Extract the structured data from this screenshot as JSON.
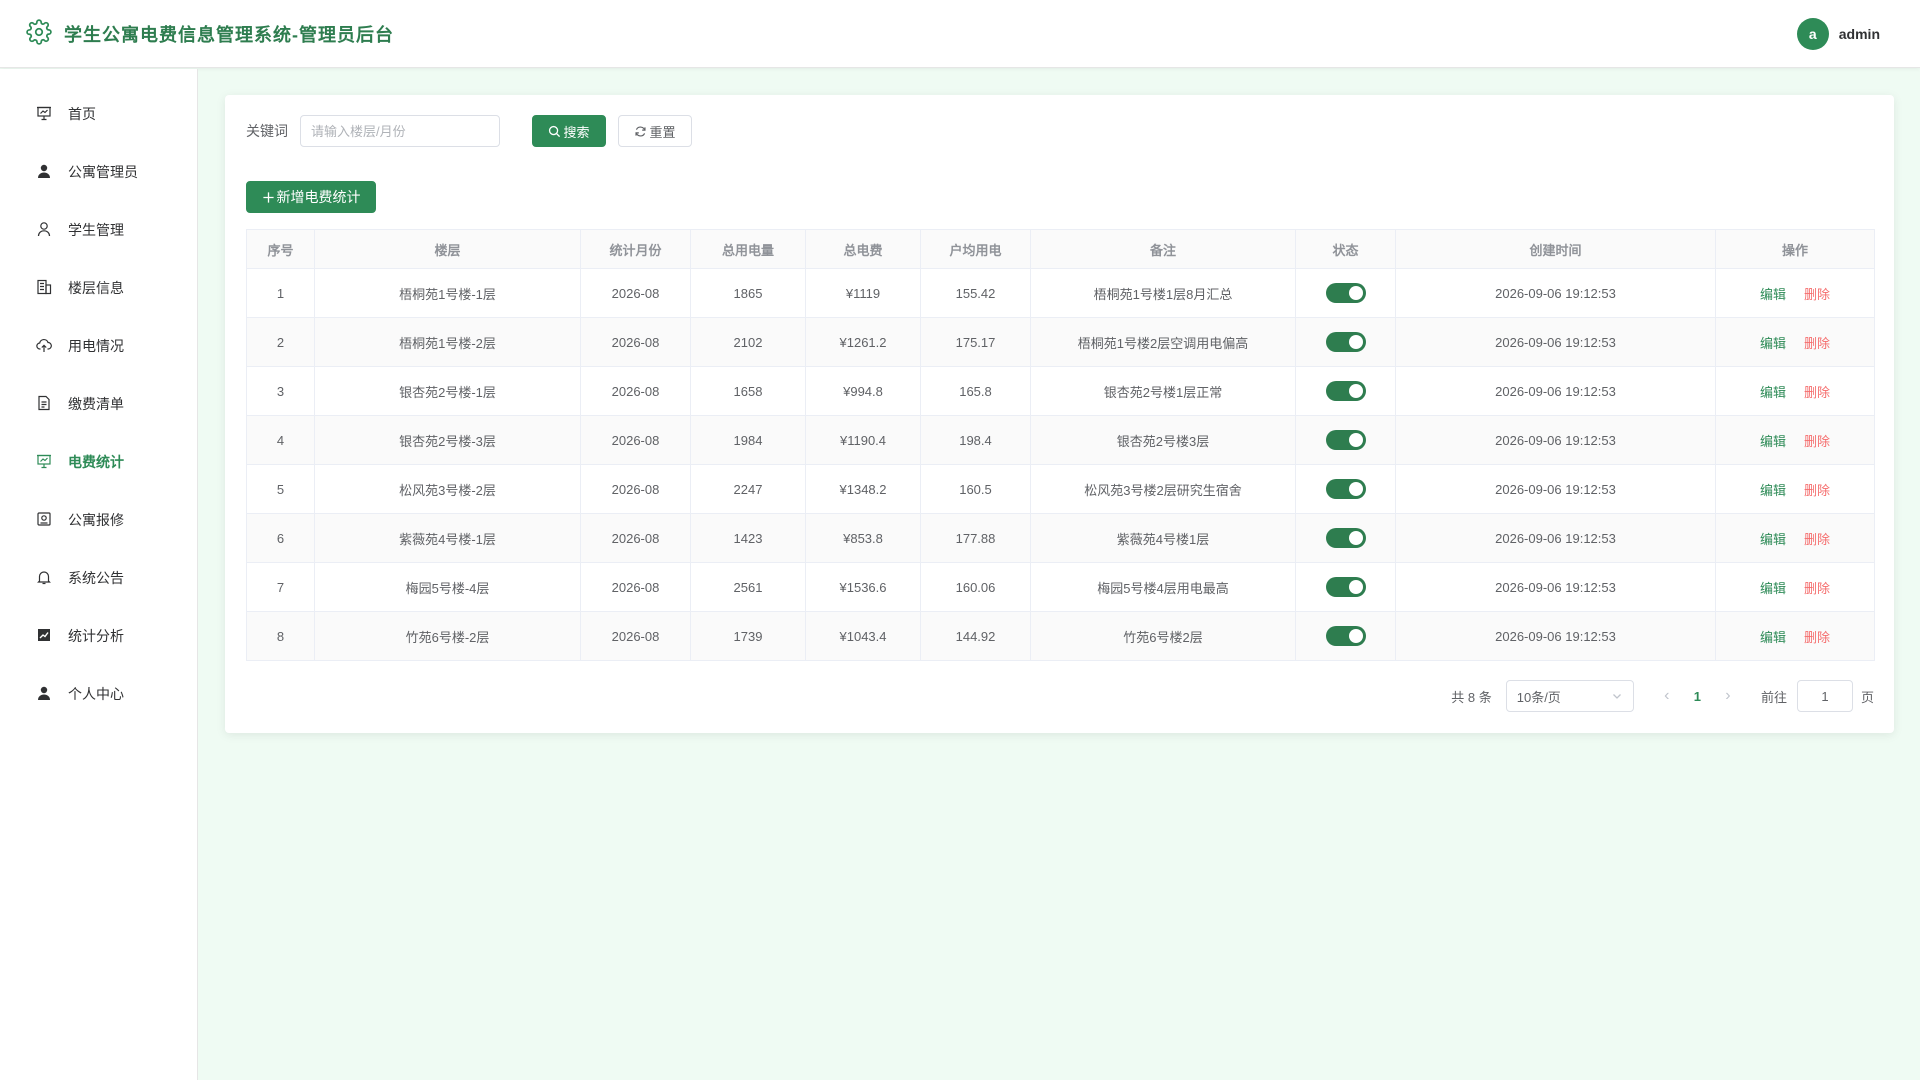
{
  "header": {
    "title": "学生公寓电费信息管理系统-管理员后台",
    "avatar_letter": "a",
    "username": "admin"
  },
  "sidebar": {
    "items": [
      {
        "label": "首页",
        "icon": "dashboard-icon",
        "active": false
      },
      {
        "label": "公寓管理员",
        "icon": "user-filled-icon",
        "active": false
      },
      {
        "label": "学生管理",
        "icon": "user-icon",
        "active": false
      },
      {
        "label": "楼层信息",
        "icon": "building-icon",
        "active": false
      },
      {
        "label": "用电情况",
        "icon": "upload-cloud-icon",
        "active": false
      },
      {
        "label": "缴费清单",
        "icon": "document-icon",
        "active": false
      },
      {
        "label": "电费统计",
        "icon": "presentation-icon",
        "active": true
      },
      {
        "label": "公寓报修",
        "icon": "repair-icon",
        "active": false
      },
      {
        "label": "系统公告",
        "icon": "bell-icon",
        "active": false
      },
      {
        "label": "统计分析",
        "icon": "chart-icon",
        "active": false
      },
      {
        "label": "个人中心",
        "icon": "user-filled-icon",
        "active": false
      }
    ]
  },
  "search": {
    "label": "关键词",
    "placeholder": "请输入楼层/月份",
    "value": "",
    "search_label": "搜索",
    "reset_label": "重置"
  },
  "toolbar": {
    "add_label": "新增电费统计"
  },
  "table": {
    "columns": [
      "序号",
      "楼层",
      "统计月份",
      "总用电量",
      "总电费",
      "户均用电",
      "备注",
      "状态",
      "创建时间",
      "操作"
    ],
    "edit_label": "编辑",
    "delete_label": "删除",
    "rows": [
      {
        "no": "1",
        "floor": "梧桐苑1号楼-1层",
        "month": "2026-08",
        "kwh": "1865",
        "fee": "¥1119",
        "avg": "155.42",
        "note": "梧桐苑1号楼1层8月汇总",
        "status": true,
        "created": "2026-09-06 19:12:53"
      },
      {
        "no": "2",
        "floor": "梧桐苑1号楼-2层",
        "month": "2026-08",
        "kwh": "2102",
        "fee": "¥1261.2",
        "avg": "175.17",
        "note": "梧桐苑1号楼2层空调用电偏高",
        "status": true,
        "created": "2026-09-06 19:12:53"
      },
      {
        "no": "3",
        "floor": "银杏苑2号楼-1层",
        "month": "2026-08",
        "kwh": "1658",
        "fee": "¥994.8",
        "avg": "165.8",
        "note": "银杏苑2号楼1层正常",
        "status": true,
        "created": "2026-09-06 19:12:53"
      },
      {
        "no": "4",
        "floor": "银杏苑2号楼-3层",
        "month": "2026-08",
        "kwh": "1984",
        "fee": "¥1190.4",
        "avg": "198.4",
        "note": "银杏苑2号楼3层",
        "status": true,
        "created": "2026-09-06 19:12:53"
      },
      {
        "no": "5",
        "floor": "松风苑3号楼-2层",
        "month": "2026-08",
        "kwh": "2247",
        "fee": "¥1348.2",
        "avg": "160.5",
        "note": "松风苑3号楼2层研究生宿舍",
        "status": true,
        "created": "2026-09-06 19:12:53"
      },
      {
        "no": "6",
        "floor": "紫薇苑4号楼-1层",
        "month": "2026-08",
        "kwh": "1423",
        "fee": "¥853.8",
        "avg": "177.88",
        "note": "紫薇苑4号楼1层",
        "status": true,
        "created": "2026-09-06 19:12:53"
      },
      {
        "no": "7",
        "floor": "梅园5号楼-4层",
        "month": "2026-08",
        "kwh": "2561",
        "fee": "¥1536.6",
        "avg": "160.06",
        "note": "梅园5号楼4层用电最高",
        "status": true,
        "created": "2026-09-06 19:12:53"
      },
      {
        "no": "8",
        "floor": "竹苑6号楼-2层",
        "month": "2026-08",
        "kwh": "1739",
        "fee": "¥1043.4",
        "avg": "144.92",
        "note": "竹苑6号楼2层",
        "status": true,
        "created": "2026-09-06 19:12:53"
      }
    ]
  },
  "pagination": {
    "total_text": "共 8 条",
    "page_size": "10条/页",
    "current_page": "1",
    "goto_label": "前往",
    "goto_value": "1",
    "page_suffix": "页"
  },
  "colors": {
    "primary": "#2e8b57",
    "danger": "#f56c6c",
    "background": "#effbf3"
  }
}
